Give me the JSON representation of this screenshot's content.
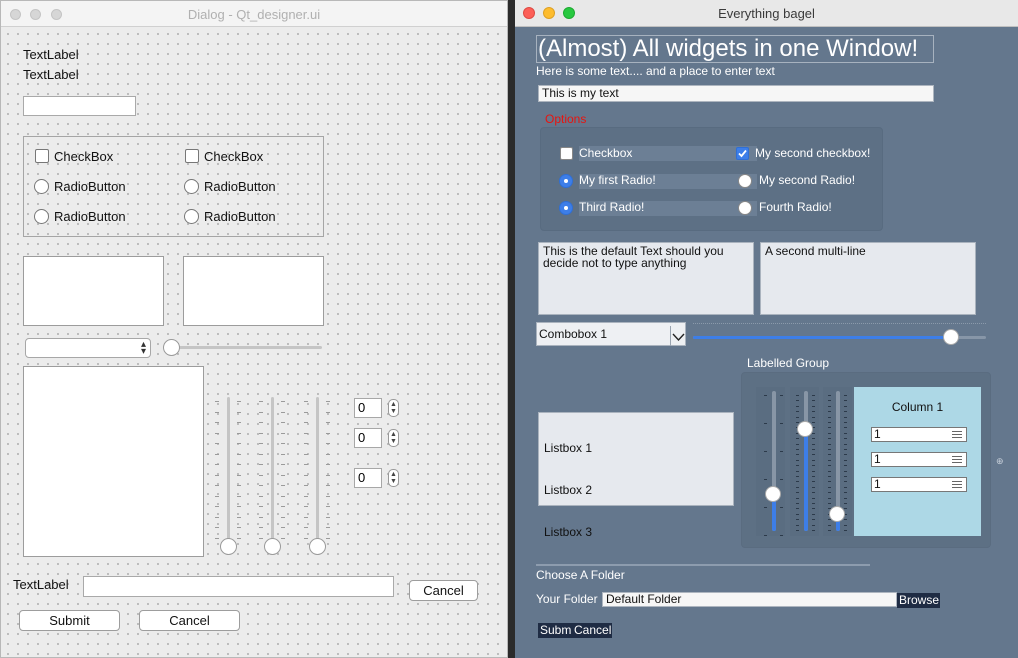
{
  "left_window": {
    "title": "Dialog - Qt_designer.ui",
    "text_label_1": "TextLabel",
    "text_label_2": "TextLabel",
    "line_edit_value": "",
    "group": {
      "checkbox_1": "CheckBox",
      "checkbox_2": "CheckBox",
      "radio_1": "RadioButton",
      "radio_2": "RadioButton",
      "radio_3": "RadioButton",
      "radio_4": "RadioButton"
    },
    "combo_value": "",
    "spinboxes": [
      "0",
      "0",
      "0"
    ],
    "bottom_label": "TextLabel",
    "bottom_input_value": "",
    "cancel_right": "Cancel",
    "submit": "Submit",
    "cancel": "Cancel"
  },
  "right_window": {
    "title": "Everything bagel",
    "heading": "(Almost) All widgets in one Window!",
    "subtext": "Here is some text.... and a place to enter text",
    "input_value": "This is my text",
    "options_label": "Options",
    "options_label_color": "#e8140f",
    "checkbox_1": {
      "label": "Checkbox",
      "checked": false
    },
    "checkbox_2": {
      "label": "My second checkbox!",
      "checked": true
    },
    "radio_1": {
      "label": "My first Radio!",
      "selected": true
    },
    "radio_2": {
      "label": "My second Radio!",
      "selected": false
    },
    "radio_3": {
      "label": "Third Radio!",
      "selected": true
    },
    "radio_4": {
      "label": "Fourth Radio!",
      "selected": false
    },
    "multiline_1": "This is the default Text should you decide not to type anything",
    "multiline_2": "A second multi-line",
    "combo_value": "Combobox 1",
    "slider_value_percent": 88,
    "labelled_group": "Labelled Group",
    "listbox": [
      "Listbox 1",
      "Listbox 2",
      "Listbox 3"
    ],
    "column_title": "Column 1",
    "column_bg": "#add8e6",
    "spins": [
      "1",
      "1",
      "1"
    ],
    "choose_folder": "Choose A Folder",
    "your_folder": "Your Folder",
    "folder_value": "Default Folder",
    "browse": "Browse",
    "submit": "Submit",
    "cancel": "Cancel",
    "accent_color": "#3d7ee8"
  }
}
